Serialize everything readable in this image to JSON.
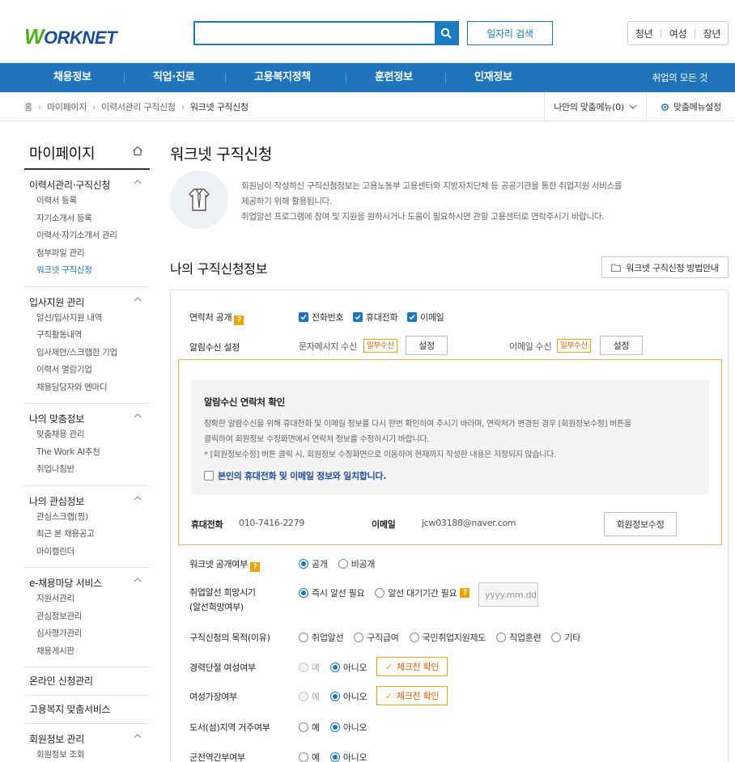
{
  "header": {
    "logo_mark": "W",
    "logo_text": "ORKNET",
    "search_placeholder": "",
    "job_search_label": "일자리 검색",
    "audience_tabs": [
      "청년",
      "여성",
      "장년"
    ]
  },
  "nav": {
    "items": [
      "채용정보",
      "직업·진로",
      "고용복지정책",
      "훈련정보",
      "인재정보"
    ],
    "right_link": "취업의 모든 것"
  },
  "breadcrumb": {
    "items": [
      "홈",
      "마이페이지",
      "이력서관리 구직신청",
      "워크넷 구직신청"
    ],
    "my_menu": "나만의 맞춤메뉴(0)",
    "menu_setting": "맞춤메뉴설정"
  },
  "sidebar": {
    "title": "마이페이지",
    "groups": [
      {
        "title": "이력서관리·구직신청",
        "items": [
          "이력서 등록",
          "자기소개서 등록",
          "이력서·자기소개서 관리",
          "첨부파일 관리",
          "워크넷 구직신청"
        ]
      },
      {
        "title": "입사지원 관리",
        "items": [
          "알선/입사지원 내역",
          "구직활동내역",
          "입사제안/스크랩한 기업",
          "이력서 열람기업",
          "채용담당자와 멘마디"
        ]
      },
      {
        "title": "나의 맞춤정보",
        "items": [
          "맞춤채용 관리",
          "The Work AI추천",
          "취업나침반"
        ]
      },
      {
        "title": "나의 관심정보",
        "items": [
          "관심스크랩(찜)",
          "최근 본 채용공고",
          "마이캘린더"
        ]
      },
      {
        "title": "e-채용마당 서비스",
        "items": [
          "지원서관리",
          "관심정보관리",
          "심사평가관리",
          "채용게시판"
        ]
      }
    ],
    "singles": [
      "온라인 신청관리",
      "고용복지 맞춤서비스"
    ],
    "last_group": {
      "title": "회원정보 관리",
      "items": [
        "회원정보 조회"
      ]
    }
  },
  "main": {
    "title": "워크넷 구직신청",
    "intro": [
      "회원님이 작성하신 구직신청정보는 고용노동부 고용센터와 지방자치단체 등 공공기관을 통한 취업지원 서비스를",
      "제공하기 위해 활용됩니다.",
      "취업알선 프로그램에 참여 및 지원을 원하시거나 도움이 필요하시면 관할 고용센터로 연락주시기 바랍니다."
    ],
    "section_title": "나의 구직신청정보",
    "guide_button": "워크넷 구직신청 방법안내"
  },
  "form": {
    "contact_public": {
      "label": "연락처 공개",
      "help": "?",
      "options": [
        "전화번호",
        "휴대전화",
        "이메일"
      ]
    },
    "notify": {
      "label": "알림수신 설정",
      "sms_label": "문자메시지 수신",
      "sms_tag": "일부수신",
      "sms_btn": "설정",
      "email_label": "이메일 수신",
      "email_tag": "일부수신",
      "email_btn": "설정"
    },
    "confirm": {
      "title": "알람수신 연락처 확인",
      "desc": [
        "정확한 알람수신을 위해 휴대전화 및 이메일 정보를 다시 한번 확인하여 주시기 바라며, 연락처가 변경된 경우 [회원정보수정] 버튼을",
        "클릭하여 회원정보 수정화면에서 연락처 정보를 수정하시기 바랍니다.",
        "* [회원정보수정] 버튼 클릭 시, 회원정보 수정화면으로 이동하며 현재까지 작성한 내용은 저장되지 않습니다."
      ],
      "check_label": "본인의 휴대전화 및 이메일 정보와 일치합니다.",
      "phone_label": "휴대전화",
      "phone_value": "010-7416-2279",
      "email_label": "이메일",
      "email_value": "jcw03188@naver.com",
      "edit_btn": "회원정보수정"
    },
    "worknet_public": {
      "label": "워크넷 공개여부",
      "help": "?",
      "options": [
        "공개",
        "비공개"
      ],
      "selected": "공개"
    },
    "hope_time": {
      "label_line1": "취업알선 희망시기",
      "label_line2": "(알선희망여부)",
      "options": [
        "즉시 알선 필요",
        "알선 대기기간 필요"
      ],
      "help": "?",
      "selected": "즉시 알선 필요",
      "date_placeholder": "yyyy.mm.dd"
    },
    "purpose": {
      "label": "구직신청의 목적(이유)",
      "options": [
        "취업알선",
        "구직급여",
        "국민취업지원제도",
        "직업훈련",
        "기타"
      ]
    },
    "career_break": {
      "label": "경력단절 여성여부",
      "options": [
        "예",
        "아니오"
      ],
      "selected": "아니오",
      "check_btn": "체크전 확인"
    },
    "female_head": {
      "label": "여성가장여부",
      "options": [
        "예",
        "아니오"
      ],
      "selected": "아니오",
      "check_btn": "체크전 확인"
    },
    "island": {
      "label": "도서(섬)지역 거주여부",
      "options": [
        "예",
        "아니오"
      ],
      "selected": "아니오"
    },
    "military": {
      "label": "군전역간부여부",
      "options": [
        "예",
        "아니오"
      ],
      "selected": "아니오"
    }
  },
  "colors": {
    "primary": "#1f74bb",
    "accent_orange": "#f0a300",
    "logo_green": "#4caf20"
  }
}
